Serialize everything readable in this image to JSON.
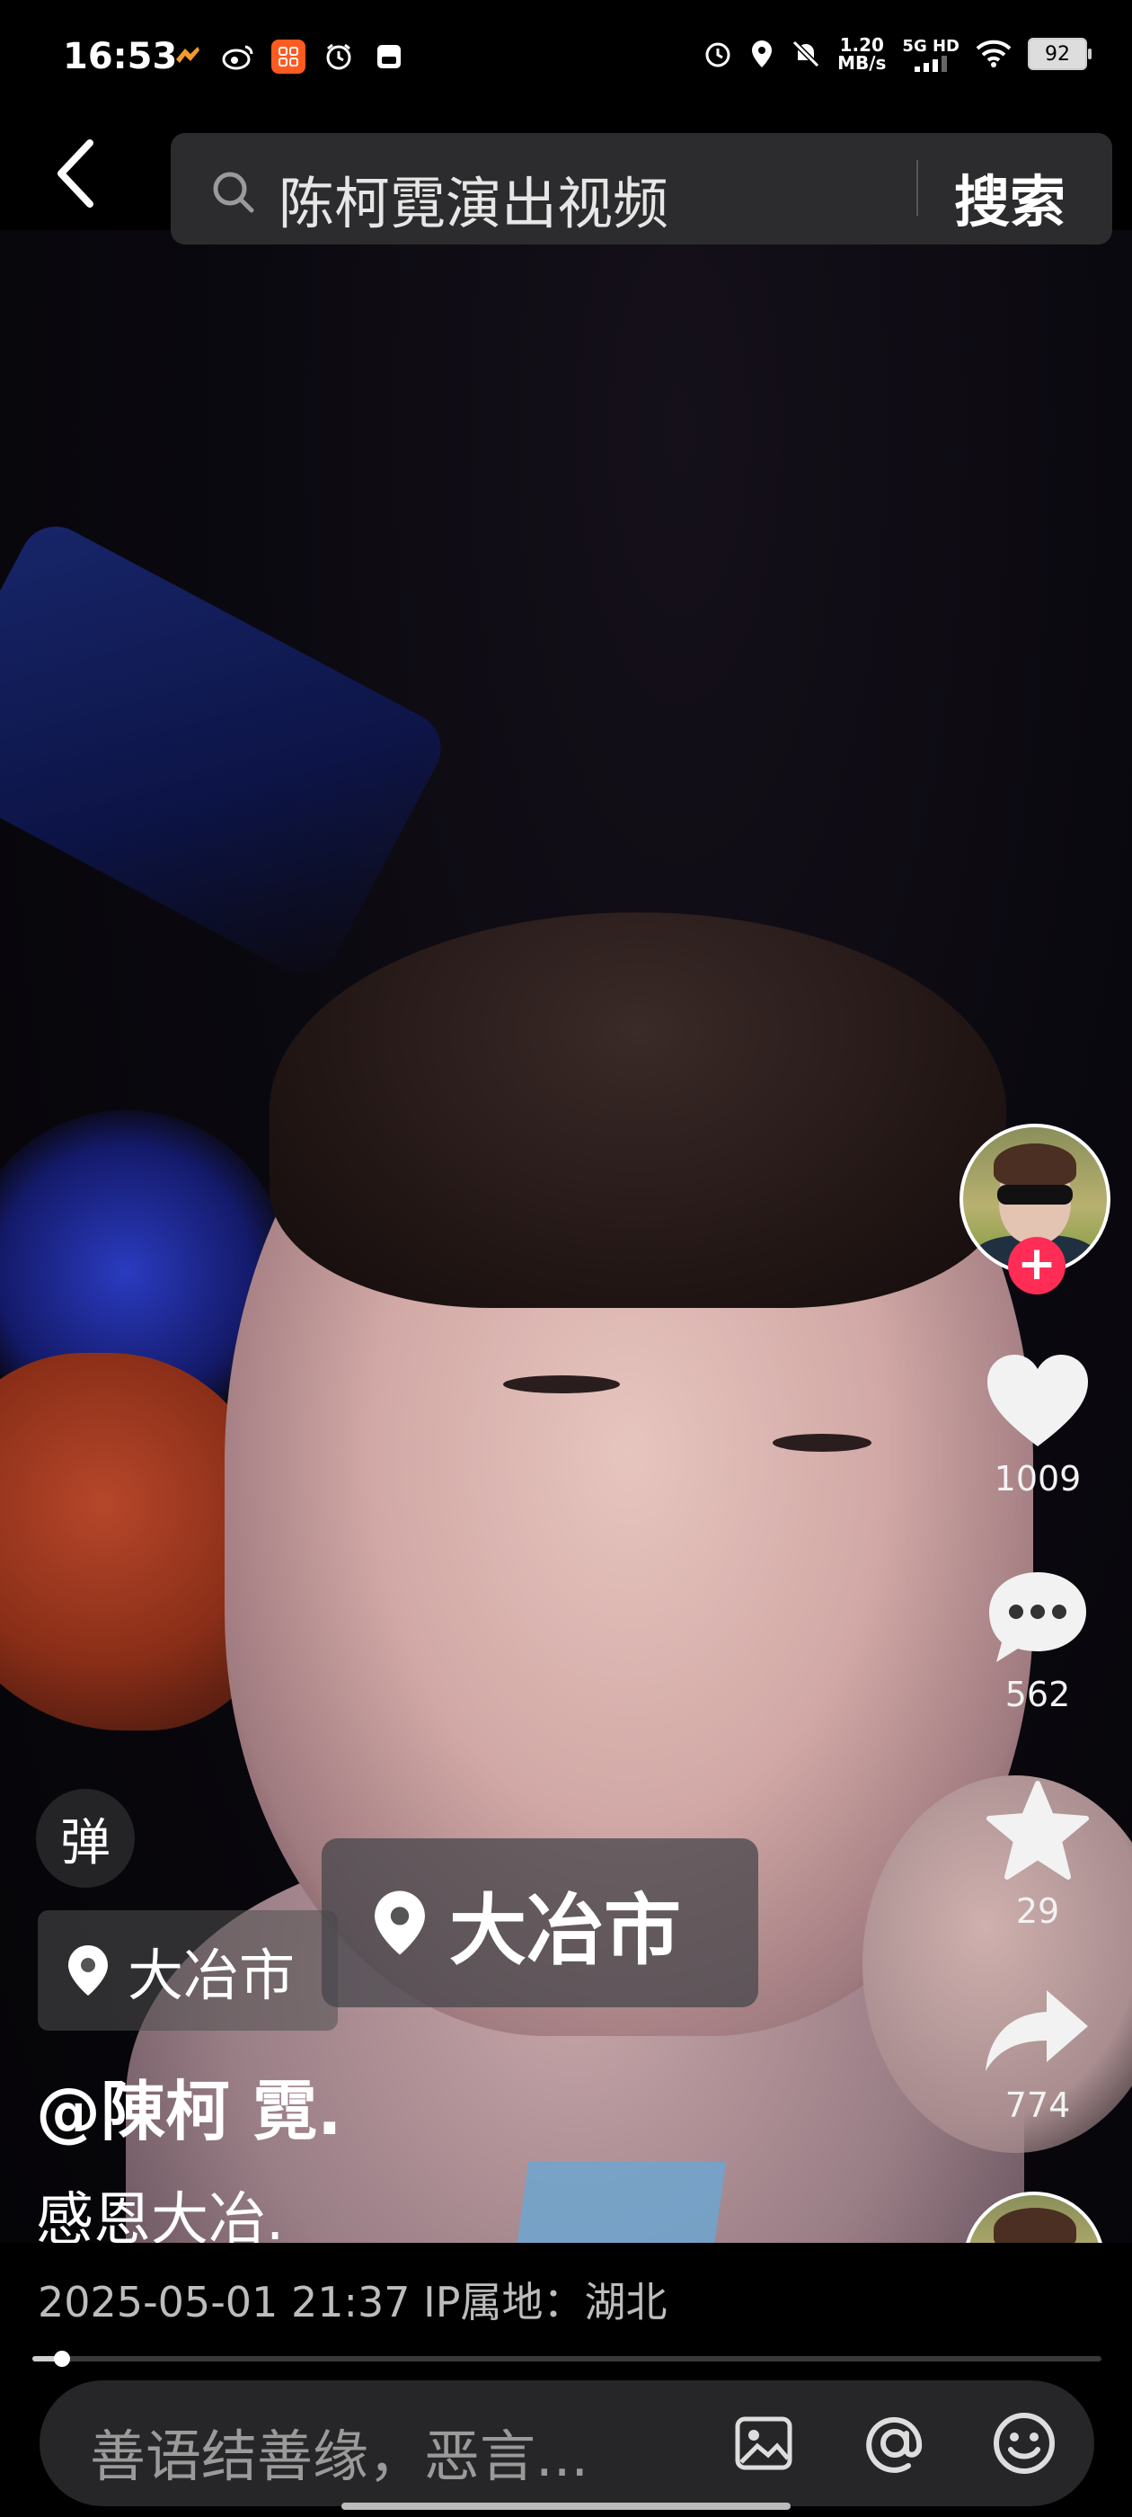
{
  "status_bar": {
    "time": "16:53",
    "network_speed_value": "1.20",
    "network_speed_unit": "MB/s",
    "network": "5G HD",
    "battery": "92"
  },
  "search": {
    "query": "陈柯霓演出视频",
    "button_label": "搜索"
  },
  "video": {
    "author_handle": "@陳柯 霓.",
    "caption": "感恩大冶.",
    "location_chip": "大冶市",
    "location_popup": "大冶市",
    "danmu_label": "弹",
    "posted_meta": "2025-05-01 21:37  IP属地：湖北",
    "progress": 0.02
  },
  "actions": {
    "likes": "1009",
    "comments": "562",
    "favorites": "29",
    "shares": "774"
  },
  "comment_bar": {
    "placeholder": "善语结善缘，恶言..."
  },
  "colors": {
    "follow_badge": "#ff2d55",
    "search_bg": "#2c2c2e",
    "comment_bg": "#262628"
  }
}
